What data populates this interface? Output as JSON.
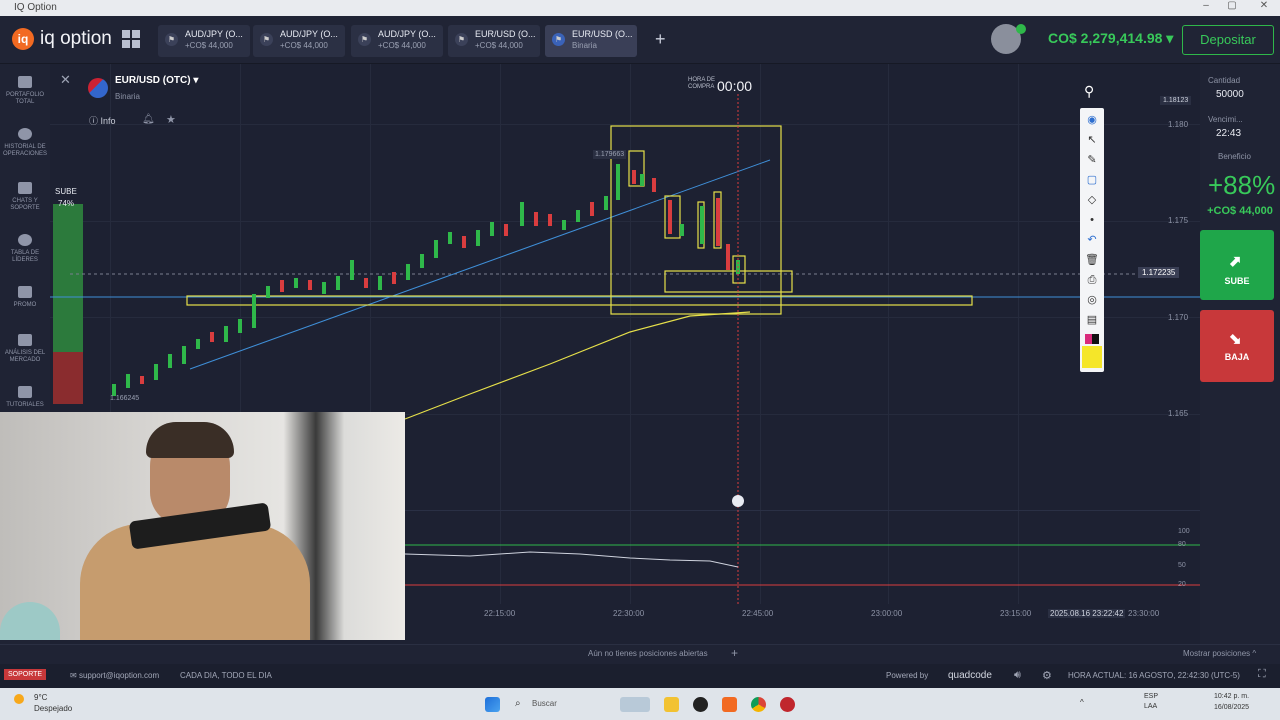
{
  "window": {
    "title": "IQ Option",
    "minimize": "–",
    "maximize": "▢",
    "close": "✕"
  },
  "topbar": {
    "logo_text": "iq option",
    "logo_mark": "iq",
    "tabs": [
      {
        "title": "AUD/JPY (O...",
        "sub": "+CO$ 44,000",
        "icon": "flag-icon"
      },
      {
        "title": "AUD/JPY (O...",
        "sub": "+CO$ 44,000",
        "icon": "flag-icon"
      },
      {
        "title": "AUD/JPY (O...",
        "sub": "+CO$ 44,000",
        "icon": "flag-icon"
      },
      {
        "title": "EUR/USD (O...",
        "sub": "+CO$ 44,000",
        "icon": "flag-icon"
      },
      {
        "title": "EUR/USD (O...",
        "sub": "Binaria",
        "icon": "flag-icon"
      }
    ],
    "add_tab": "+",
    "balance": "CO$ 2,279,414.98 ▾",
    "deposit": "Depositar"
  },
  "leftnav": [
    {
      "label": "PORTAFOLIO TOTAL",
      "icon": "portfolio-icon"
    },
    {
      "label": "HISTORIAL DE OPERACIONES",
      "icon": "history-icon"
    },
    {
      "label": "CHATS Y SOPORTE",
      "icon": "chat-icon"
    },
    {
      "label": "TABLA DE LÍDERES",
      "icon": "leaders-icon"
    },
    {
      "label": "PROMO",
      "icon": "promo-icon"
    },
    {
      "label": "ANÁLISIS DEL MERCADO",
      "icon": "analysis-icon"
    },
    {
      "label": "TUTORIALES",
      "icon": "tutorial-icon"
    }
  ],
  "chart": {
    "pair": "EUR/USD (OTC) ▾",
    "pair_sub": "Binaria",
    "info": "Info",
    "close": "✕",
    "hora_label_1": "HORA DE",
    "hora_label_2": "COMPRA",
    "hora_value": "00:00",
    "sentiment_label": "SUBE",
    "sentiment_value": "74%",
    "price_tag": "1.172235",
    "high_tag": "1.18123",
    "low_tag": "1.166245",
    "label_1179": "1.179663",
    "y_ticks": [
      "1.180",
      "1.175",
      "1.170",
      "1.165"
    ],
    "x_ticks": [
      "22:15:00",
      "22:30:00",
      "22:45:00",
      "23:00:00",
      "23:15:00",
      "23:30:00"
    ],
    "x_date": "2025.08.16 23:22:42",
    "osc_ticks": [
      "100",
      "80",
      "50",
      "20"
    ]
  },
  "right_panel": {
    "cantidad_label": "Cantidad",
    "cantidad_value": "50000",
    "venc_label": "Vencimi...",
    "venc_value": "22:43",
    "beneficio_label": "Beneficio",
    "percent": "+88%",
    "profit": "+CO$ 44,000",
    "sube": "SUBE",
    "baja": "BAJA"
  },
  "bottom": {
    "no_positions": "Aún no tienes posiciones abiertas",
    "plus": "+",
    "mostrar": "Mostrar posiciones ^"
  },
  "status": {
    "soporte": "SOPORTE",
    "email": "support@iqoption.com",
    "always": "CADA DIA, TODO EL DIA",
    "powered": "Powered by",
    "quadcode": "quadcode",
    "hora_actual": "HORA ACTUAL:  16 AGOSTO, 22:42:30 (UTC-5)"
  },
  "taskbar": {
    "weather_temp": "9°C",
    "weather_text": "Despejado",
    "search": "Buscar",
    "lang1": "ESP",
    "lang2": "LAA",
    "time": "10:42 p. m.",
    "date": "16/08/2025"
  },
  "colors": {
    "green": "#38c95a",
    "red": "#c8383a",
    "yellow": "#e6e04a",
    "blue": "#3f8fd8"
  }
}
